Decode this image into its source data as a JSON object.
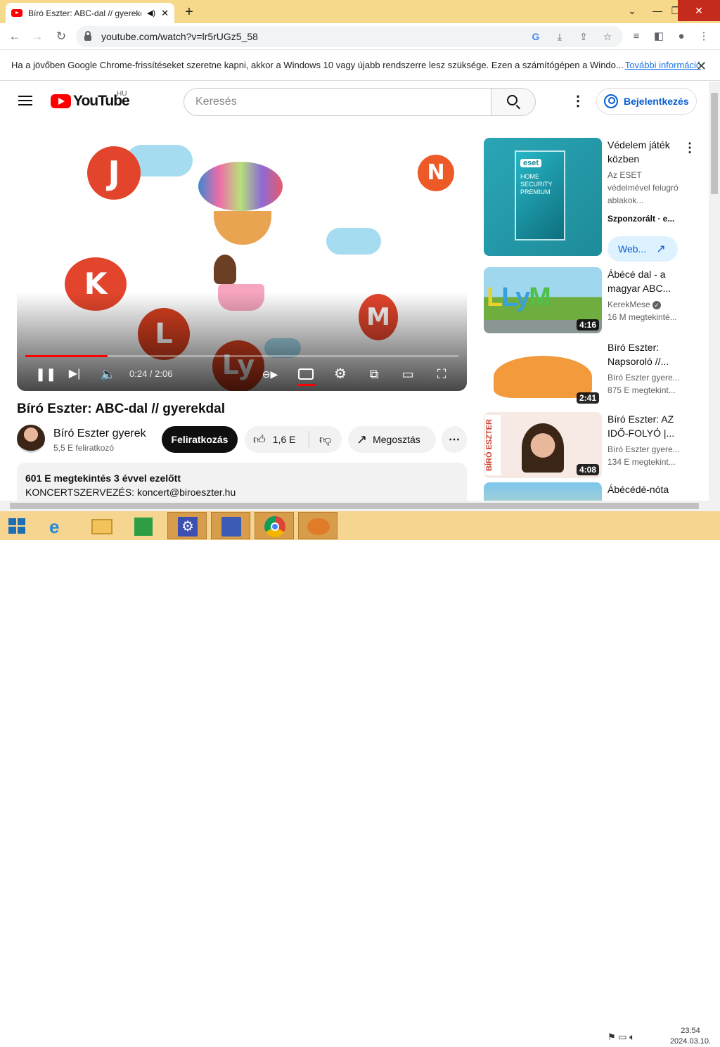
{
  "browser": {
    "tab_title": "Bíró Eszter: ABC-dal // gyerekdal",
    "url": "youtube.com/watch?v=lr5rUGz5_58",
    "info_text": "Ha a jövőben Google Chrome-frissítéseket szeretne kapni, akkor a Windows 10 vagy újabb rendszerre lesz szüksége. Ezen a számítógépen a Windo...",
    "info_link": "További információ"
  },
  "youtube": {
    "logo_text": "YouTube",
    "country": "HU",
    "search_placeholder": "Keresés",
    "signin_label": "Bejelentkezés"
  },
  "player": {
    "time": "0:24 / 2:06",
    "progress": 0.19,
    "balloon_letters": [
      "J",
      "N",
      "K",
      "L",
      "M",
      "Ly"
    ]
  },
  "video": {
    "title": "Bíró Eszter: ABC-dal // gyerekdal",
    "channel": "Bíró Eszter gyerek",
    "subscribers": "5,5 E feliratkozó",
    "subscribe_label": "Feliratkozás",
    "likes": "1,6 E",
    "share_label": "Megosztás",
    "desc_line1": "601 E megtekintés  3 évvel ezelőtt",
    "desc_line2": "KONCERTSZERVEZÉS: koncert@biroeszter.hu"
  },
  "sidebar": {
    "ad": {
      "title": "Védelem játék közben",
      "desc": "Az ESET védelmével felugró ablakok...",
      "sponsor": "Szponzorált · e...",
      "button": "Web...",
      "box_brand": "eset",
      "box_text": "HOME SECURITY PREMIUM"
    },
    "items": [
      {
        "title": "Ábécé dal - a magyar ABC...",
        "channel": "KerekMese",
        "views": "16 M megtekinté...",
        "duration": "4:16"
      },
      {
        "title": "Bíró Eszter: Napsoroló //...",
        "channel": "Bíró Eszter gyere...",
        "views": "875 E megtekint...",
        "duration": "2:41"
      },
      {
        "title": "Bíró Eszter: AZ IDŐ-FOLYÓ |...",
        "channel": "Bíró Eszter gyere...",
        "views": "134 E megtekint...",
        "duration": "4:08",
        "thumb_text": "BÍRÓ ESZTER"
      },
      {
        "title": "Ábécédé-nóta"
      }
    ]
  },
  "taskbar": {
    "time": "23:54",
    "date": "2024.03.10."
  }
}
